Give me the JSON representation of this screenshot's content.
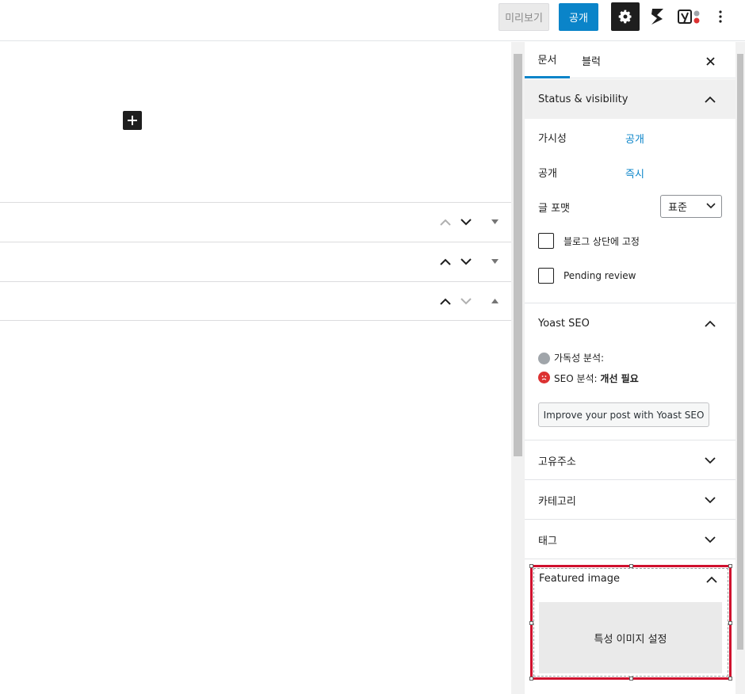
{
  "topbar": {
    "preview_label": "미리보기",
    "publish_label": "공개",
    "settings_icon": "gear-icon",
    "s_icon": "s-plugin-icon",
    "yoast_icon": "yoast-icon",
    "more_icon": "more-vertical-icon"
  },
  "sidebar": {
    "tabs": [
      {
        "label": "문서"
      },
      {
        "label": "블럭"
      }
    ],
    "status": {
      "title": "Status & visibility",
      "visibility_label": "가시성",
      "visibility_value": "공개",
      "publish_label": "공개",
      "publish_value": "즉시",
      "format_label": "글 포맷",
      "format_value": "표준",
      "sticky_label": "블로그 상단에 고정",
      "pending_label": "Pending review"
    },
    "yoast": {
      "title": "Yoast SEO",
      "readability_label": "가독성 분석:",
      "seo_label": "SEO 분석:",
      "seo_value": "개선 필요",
      "button_label": "Improve your post with Yoast SEO"
    },
    "panels": [
      {
        "title": "고유주소"
      },
      {
        "title": "카테고리"
      },
      {
        "title": "태그"
      }
    ],
    "featured": {
      "title": "Featured image",
      "set_label": "특성 이미지 설정"
    }
  },
  "colors": {
    "accent": "#0a84c9",
    "highlight": "#d0102e",
    "dark": "#1e1e1e"
  }
}
